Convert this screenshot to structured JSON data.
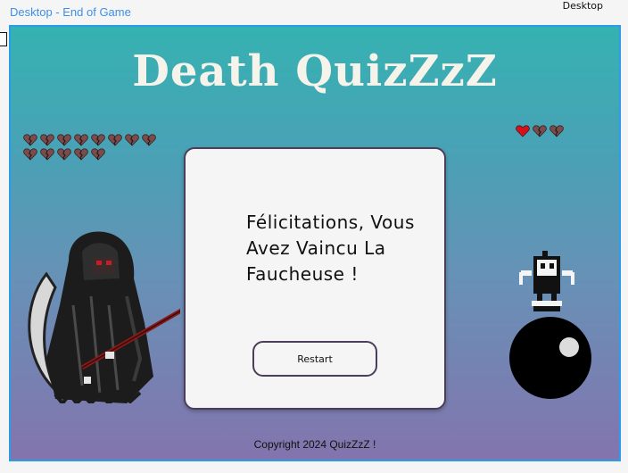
{
  "frame": {
    "title": "Desktop - End of Game",
    "device_label": "Desktop"
  },
  "game": {
    "logo": "Death QuizZzZ"
  },
  "lives": {
    "left_broken_count": 13,
    "right": [
      "full",
      "broken",
      "broken"
    ],
    "colors": {
      "full": "#d9101c",
      "broken": "#7a4c4c"
    }
  },
  "result": {
    "message": "Félicitations, Vous Avez Vaincu La Faucheuse !",
    "restart_label": "Restart"
  },
  "footer": {
    "copyright": "Copyright 2024 QuizZzZ !"
  },
  "icons": {
    "reaper": "grim-reaper-icon",
    "bomb": "bomb-character-icon",
    "heart_full": "heart-icon",
    "heart_broken": "broken-heart-icon"
  }
}
